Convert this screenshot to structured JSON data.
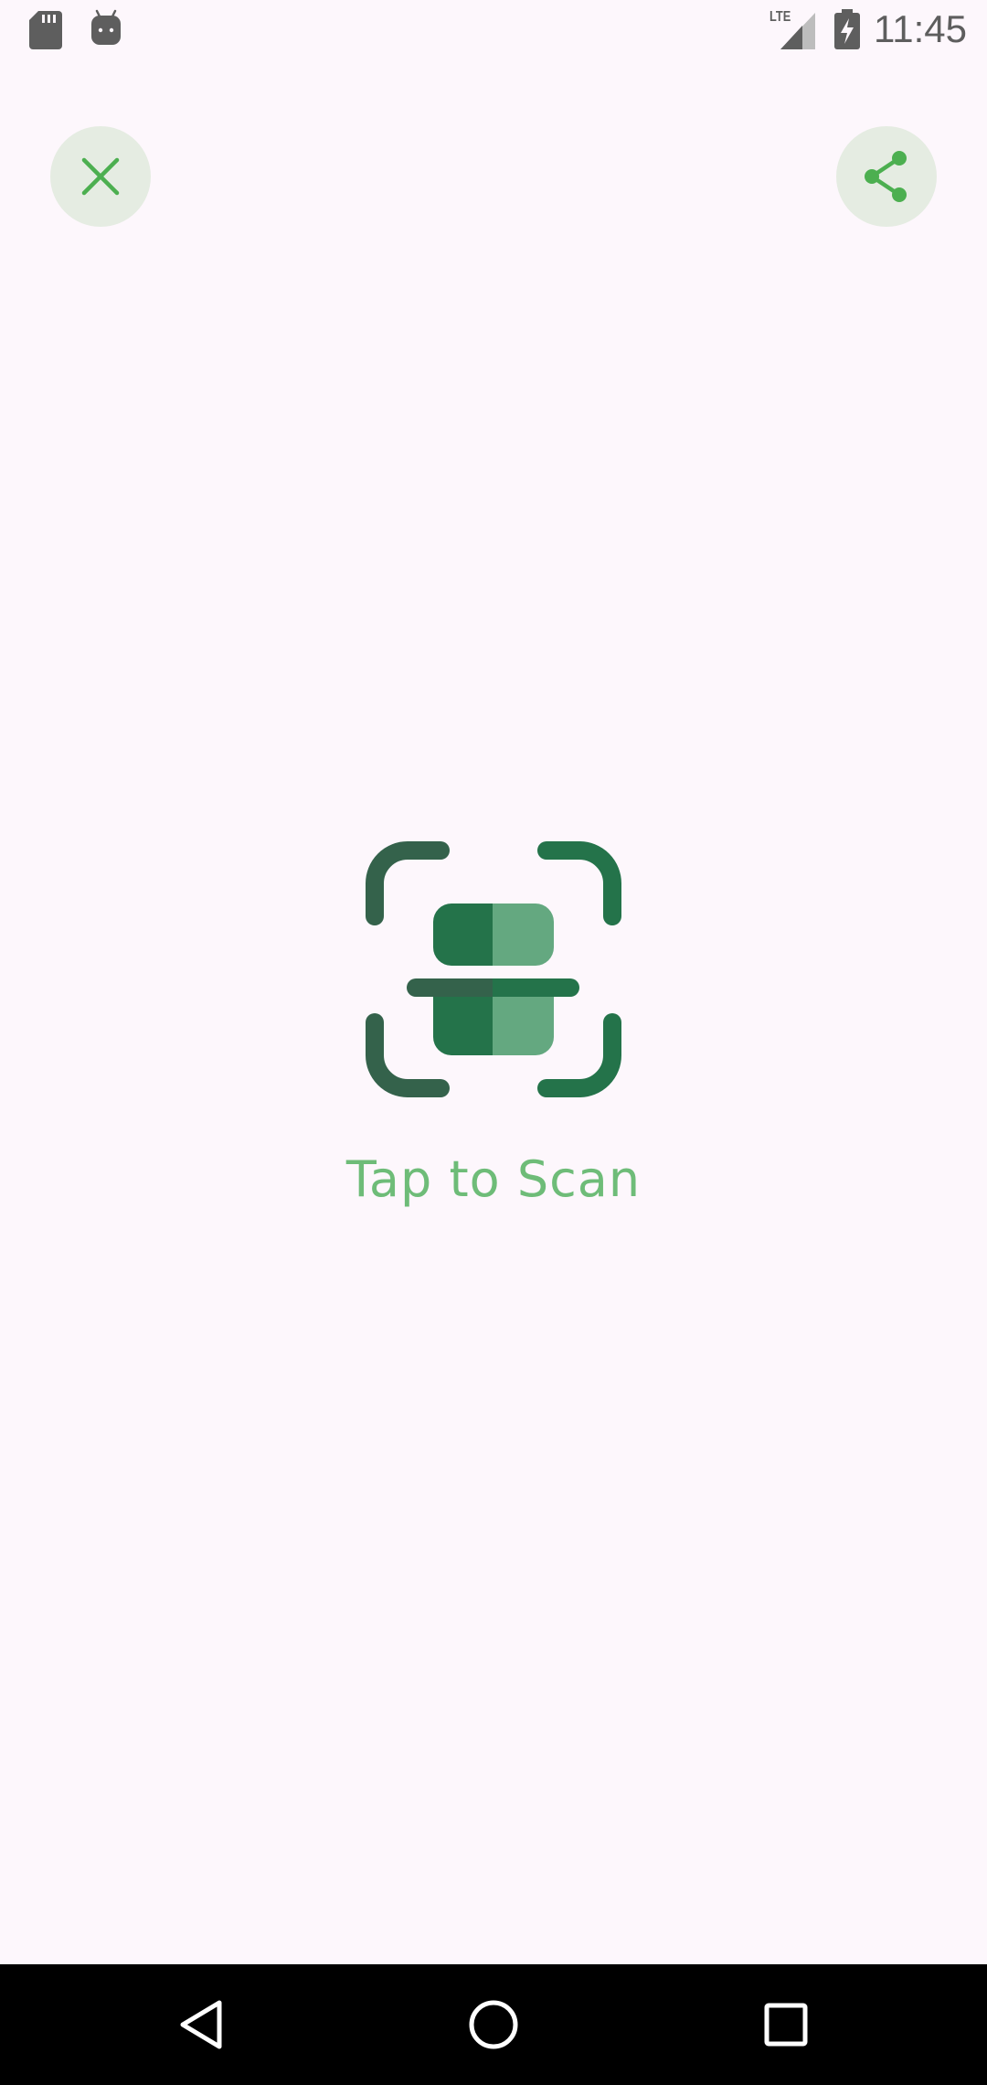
{
  "status_bar": {
    "time": "11:45",
    "network": "LTE",
    "icons": [
      "sd-card-icon",
      "android-icon",
      "signal-icon",
      "battery-charging-icon"
    ]
  },
  "toolbar": {
    "close_icon": "close-icon",
    "share_icon": "share-icon"
  },
  "main": {
    "scan_label": "Tap to Scan",
    "scan_icon": "barcode-scan-icon"
  },
  "navigation": {
    "icons": [
      "back-icon",
      "home-icon",
      "recents-icon"
    ]
  },
  "colors": {
    "background": "#fdf7fc",
    "button_background": "#e5ece2",
    "accent": "#4caf50",
    "scan_dark": "#34624b",
    "scan_mid": "#24734a",
    "scan_light": "#64a880",
    "label": "#6ebc78"
  }
}
